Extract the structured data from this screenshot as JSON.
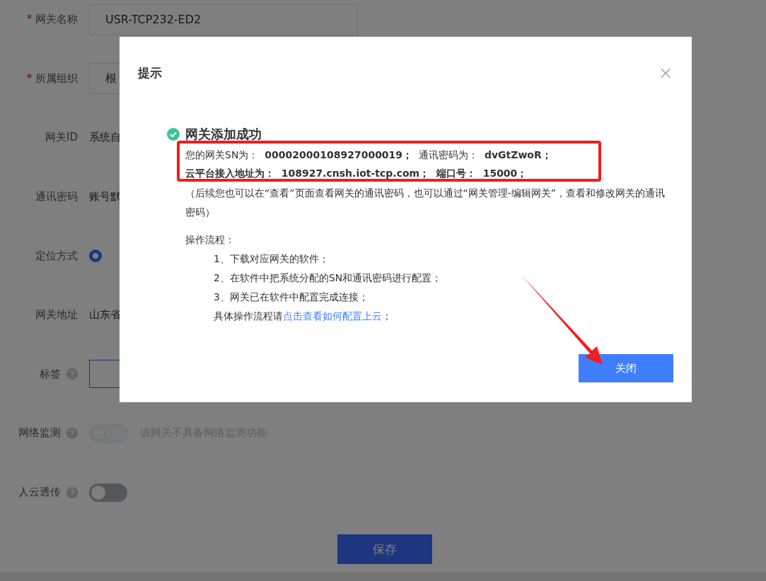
{
  "form": {
    "fields": [
      {
        "label": "网关名称",
        "required": true,
        "help": false,
        "kind": "input",
        "value": "USR-TCP232-ED2"
      },
      {
        "label": "所属组织",
        "required": true,
        "help": false,
        "kind": "input",
        "value": "根"
      },
      {
        "label": "网关ID",
        "required": false,
        "help": false,
        "kind": "text",
        "value": "系统自"
      },
      {
        "label": "通讯密码",
        "required": false,
        "help": false,
        "kind": "text",
        "value": "账号默"
      },
      {
        "label": "定位方式",
        "required": false,
        "help": false,
        "kind": "radio",
        "selected": true
      },
      {
        "label": "网关地址",
        "required": false,
        "help": false,
        "kind": "text",
        "value": "山东省"
      },
      {
        "label": "标签",
        "required": false,
        "help": true,
        "kind": "button"
      },
      {
        "label": "网络监测",
        "required": false,
        "help": true,
        "kind": "switch",
        "on": false,
        "disabled": true,
        "note": "该网关不具备网络监测功能"
      },
      {
        "label": "人云透传",
        "required": false,
        "help": true,
        "kind": "switch",
        "on": false,
        "disabled": false
      }
    ],
    "save_button": "保存"
  },
  "dialog": {
    "title": "提示",
    "close": "×",
    "success": "网关添加成功",
    "sn_line": "您的网关SN为：  **00002000108927000019；**  通讯密码为：  **dvGtZwoR；**",
    "address_line": "云平台接入地址为：  108927.cnsh.iot-tcp.com；  端口号：  15000；",
    "note": "（后续您也可以在“查看”页面查看网关的通讯密码，也可以通过“网关管理-编辑网关”，查看和修改网关的通讯密码）",
    "steps_title": "操作流程：",
    "steps": [
      "1、下载对应网关的软件；",
      "2、在软件中把系统分配的SN和通讯密码进行配置；",
      "3、网关已在软件中配置完成连接；"
    ],
    "more_prefix": "具体操作流程请",
    "more_link": "点击查看如何配置上云",
    "more_suffix": "；",
    "button": "关闭"
  }
}
